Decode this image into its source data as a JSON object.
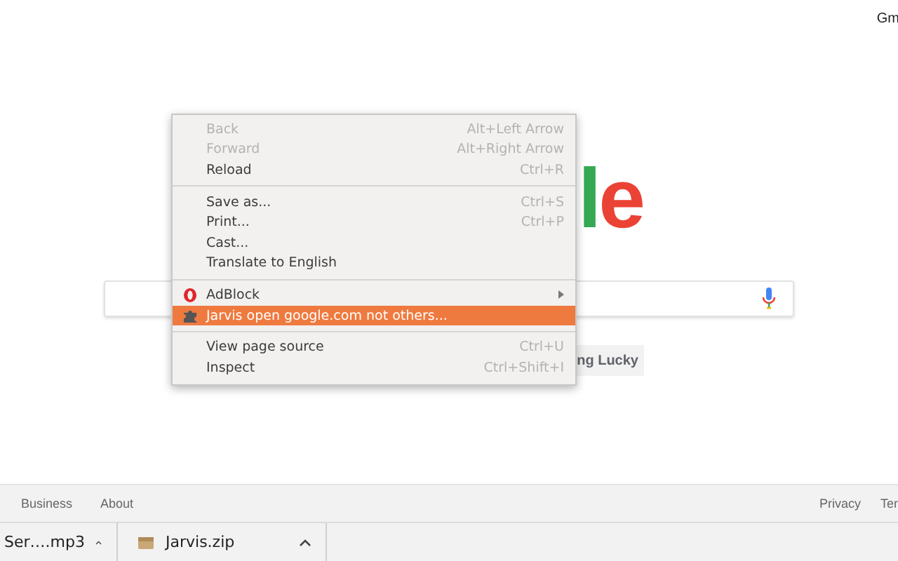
{
  "header": {
    "link": "Gm"
  },
  "logo": [
    {
      "char": "l",
      "color": "#34a853"
    },
    {
      "char": "e",
      "color": "#ea4335"
    }
  ],
  "lucky_button": "ng Lucky",
  "context_menu": [
    {
      "kind": "item",
      "label": "Back",
      "shortcut": "Alt+Left Arrow",
      "disabled": true,
      "selected": false
    },
    {
      "kind": "item",
      "label": "Forward",
      "shortcut": "Alt+Right Arrow",
      "disabled": true,
      "selected": false
    },
    {
      "kind": "item",
      "label": "Reload",
      "shortcut": "Ctrl+R",
      "disabled": false,
      "selected": false
    },
    {
      "kind": "separator"
    },
    {
      "kind": "item",
      "label": "Save as...",
      "shortcut": "Ctrl+S",
      "disabled": false,
      "selected": false
    },
    {
      "kind": "item",
      "label": "Print...",
      "shortcut": "Ctrl+P",
      "disabled": false,
      "selected": false
    },
    {
      "kind": "item",
      "label": "Cast...",
      "disabled": false,
      "selected": false
    },
    {
      "kind": "item",
      "label": "Translate to English",
      "disabled": false,
      "selected": false
    },
    {
      "kind": "separator"
    },
    {
      "kind": "adblock",
      "label": "AdBlock",
      "submenu": true,
      "disabled": false,
      "selected": false
    },
    {
      "kind": "extension",
      "label": "Jarvis open google.com not others...",
      "disabled": false,
      "selected": true
    },
    {
      "kind": "separator"
    },
    {
      "kind": "item",
      "label": "View page source",
      "shortcut": "Ctrl+U",
      "disabled": false,
      "selected": false
    },
    {
      "kind": "item",
      "label": "Inspect",
      "shortcut": "Ctrl+Shift+I",
      "disabled": false,
      "selected": false
    }
  ],
  "footer": {
    "left": [
      "Business",
      "About"
    ],
    "right": [
      "Privacy",
      "Ter"
    ]
  },
  "downloads": [
    {
      "name": "Ser….mp3",
      "kind": "audio"
    },
    {
      "name": "Jarvis.zip",
      "kind": "archive"
    }
  ]
}
